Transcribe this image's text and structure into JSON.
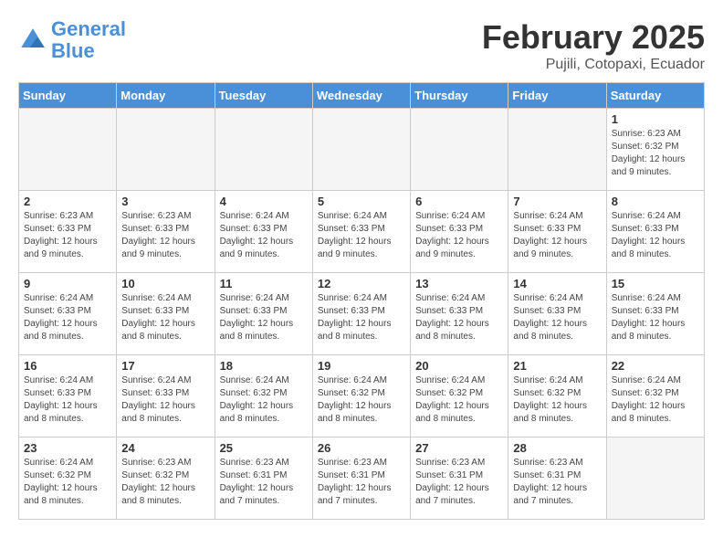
{
  "logo": {
    "line1": "General",
    "line2": "Blue"
  },
  "title": "February 2025",
  "subtitle": "Pujili, Cotopaxi, Ecuador",
  "days_header": [
    "Sunday",
    "Monday",
    "Tuesday",
    "Wednesday",
    "Thursday",
    "Friday",
    "Saturday"
  ],
  "weeks": [
    [
      {
        "day": "",
        "info": ""
      },
      {
        "day": "",
        "info": ""
      },
      {
        "day": "",
        "info": ""
      },
      {
        "day": "",
        "info": ""
      },
      {
        "day": "",
        "info": ""
      },
      {
        "day": "",
        "info": ""
      },
      {
        "day": "1",
        "info": "Sunrise: 6:23 AM\nSunset: 6:32 PM\nDaylight: 12 hours and 9 minutes."
      }
    ],
    [
      {
        "day": "2",
        "info": "Sunrise: 6:23 AM\nSunset: 6:33 PM\nDaylight: 12 hours and 9 minutes."
      },
      {
        "day": "3",
        "info": "Sunrise: 6:23 AM\nSunset: 6:33 PM\nDaylight: 12 hours and 9 minutes."
      },
      {
        "day": "4",
        "info": "Sunrise: 6:24 AM\nSunset: 6:33 PM\nDaylight: 12 hours and 9 minutes."
      },
      {
        "day": "5",
        "info": "Sunrise: 6:24 AM\nSunset: 6:33 PM\nDaylight: 12 hours and 9 minutes."
      },
      {
        "day": "6",
        "info": "Sunrise: 6:24 AM\nSunset: 6:33 PM\nDaylight: 12 hours and 9 minutes."
      },
      {
        "day": "7",
        "info": "Sunrise: 6:24 AM\nSunset: 6:33 PM\nDaylight: 12 hours and 9 minutes."
      },
      {
        "day": "8",
        "info": "Sunrise: 6:24 AM\nSunset: 6:33 PM\nDaylight: 12 hours and 8 minutes."
      }
    ],
    [
      {
        "day": "9",
        "info": "Sunrise: 6:24 AM\nSunset: 6:33 PM\nDaylight: 12 hours and 8 minutes."
      },
      {
        "day": "10",
        "info": "Sunrise: 6:24 AM\nSunset: 6:33 PM\nDaylight: 12 hours and 8 minutes."
      },
      {
        "day": "11",
        "info": "Sunrise: 6:24 AM\nSunset: 6:33 PM\nDaylight: 12 hours and 8 minutes."
      },
      {
        "day": "12",
        "info": "Sunrise: 6:24 AM\nSunset: 6:33 PM\nDaylight: 12 hours and 8 minutes."
      },
      {
        "day": "13",
        "info": "Sunrise: 6:24 AM\nSunset: 6:33 PM\nDaylight: 12 hours and 8 minutes."
      },
      {
        "day": "14",
        "info": "Sunrise: 6:24 AM\nSunset: 6:33 PM\nDaylight: 12 hours and 8 minutes."
      },
      {
        "day": "15",
        "info": "Sunrise: 6:24 AM\nSunset: 6:33 PM\nDaylight: 12 hours and 8 minutes."
      }
    ],
    [
      {
        "day": "16",
        "info": "Sunrise: 6:24 AM\nSunset: 6:33 PM\nDaylight: 12 hours and 8 minutes."
      },
      {
        "day": "17",
        "info": "Sunrise: 6:24 AM\nSunset: 6:33 PM\nDaylight: 12 hours and 8 minutes."
      },
      {
        "day": "18",
        "info": "Sunrise: 6:24 AM\nSunset: 6:32 PM\nDaylight: 12 hours and 8 minutes."
      },
      {
        "day": "19",
        "info": "Sunrise: 6:24 AM\nSunset: 6:32 PM\nDaylight: 12 hours and 8 minutes."
      },
      {
        "day": "20",
        "info": "Sunrise: 6:24 AM\nSunset: 6:32 PM\nDaylight: 12 hours and 8 minutes."
      },
      {
        "day": "21",
        "info": "Sunrise: 6:24 AM\nSunset: 6:32 PM\nDaylight: 12 hours and 8 minutes."
      },
      {
        "day": "22",
        "info": "Sunrise: 6:24 AM\nSunset: 6:32 PM\nDaylight: 12 hours and 8 minutes."
      }
    ],
    [
      {
        "day": "23",
        "info": "Sunrise: 6:24 AM\nSunset: 6:32 PM\nDaylight: 12 hours and 8 minutes."
      },
      {
        "day": "24",
        "info": "Sunrise: 6:23 AM\nSunset: 6:32 PM\nDaylight: 12 hours and 8 minutes."
      },
      {
        "day": "25",
        "info": "Sunrise: 6:23 AM\nSunset: 6:31 PM\nDaylight: 12 hours and 7 minutes."
      },
      {
        "day": "26",
        "info": "Sunrise: 6:23 AM\nSunset: 6:31 PM\nDaylight: 12 hours and 7 minutes."
      },
      {
        "day": "27",
        "info": "Sunrise: 6:23 AM\nSunset: 6:31 PM\nDaylight: 12 hours and 7 minutes."
      },
      {
        "day": "28",
        "info": "Sunrise: 6:23 AM\nSunset: 6:31 PM\nDaylight: 12 hours and 7 minutes."
      },
      {
        "day": "",
        "info": ""
      }
    ]
  ]
}
